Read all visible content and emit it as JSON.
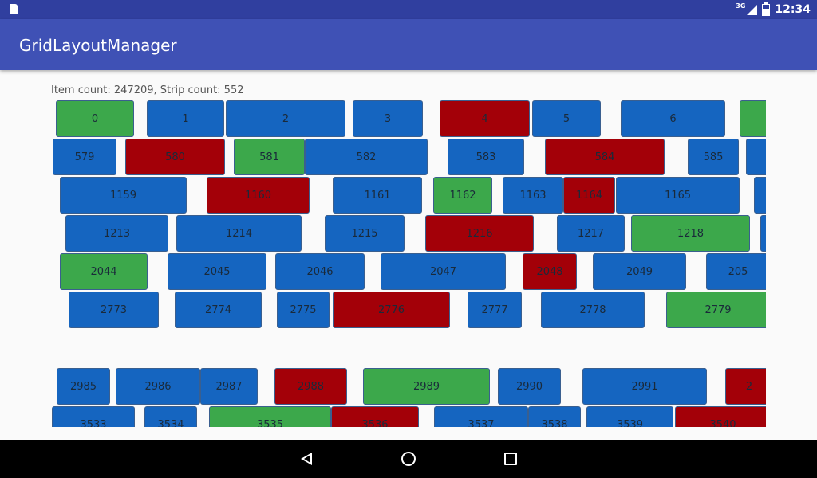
{
  "status_bar": {
    "time": "12:34",
    "network": "3G"
  },
  "app_bar": {
    "title": "GridLayoutManager"
  },
  "info": {
    "text": "Item count: 247209, Strip count: 552"
  },
  "colors": {
    "blue": "#1565c0",
    "red": "#a30008",
    "green": "#3ca84b"
  },
  "rows": [
    {
      "items": [
        [
          "0",
          "green"
        ],
        [
          "1",
          "blue"
        ],
        [
          "2",
          "blue"
        ],
        [
          "3",
          "blue"
        ],
        [
          "4",
          "red"
        ],
        [
          "5",
          "blue"
        ],
        [
          "6",
          "blue"
        ],
        [
          "",
          "green"
        ]
      ]
    },
    {
      "items": [
        [
          "579",
          "blue"
        ],
        [
          "580",
          "red"
        ],
        [
          "581",
          "green"
        ],
        [
          "582",
          "blue"
        ],
        [
          "583",
          "blue"
        ],
        [
          "584",
          "red"
        ],
        [
          "585",
          "blue"
        ],
        [
          "",
          "blue"
        ]
      ]
    },
    {
      "items": [
        [
          "1159",
          "blue"
        ],
        [
          "1160",
          "red"
        ],
        [
          "1161",
          "blue"
        ],
        [
          "1162",
          "green"
        ],
        [
          "1163",
          "blue"
        ],
        [
          "1164",
          "red"
        ],
        [
          "1165",
          "blue"
        ],
        [
          "",
          "blue"
        ]
      ]
    },
    {
      "items": [
        [
          "1213",
          "blue"
        ],
        [
          "1214",
          "blue"
        ],
        [
          "1215",
          "blue"
        ],
        [
          "1216",
          "red"
        ],
        [
          "1217",
          "blue"
        ],
        [
          "1218",
          "green"
        ],
        [
          "",
          "blue"
        ]
      ]
    },
    {
      "items": [
        [
          "2044",
          "green"
        ],
        [
          "2045",
          "blue"
        ],
        [
          "2046",
          "blue"
        ],
        [
          "2047",
          "blue"
        ],
        [
          "2048",
          "red"
        ],
        [
          "2049",
          "blue"
        ],
        [
          "205",
          "blue"
        ]
      ]
    },
    {
      "items": [
        [
          "2773",
          "blue"
        ],
        [
          "2774",
          "blue"
        ],
        [
          "2775",
          "blue"
        ],
        [
          "2776",
          "red"
        ],
        [
          "2777",
          "blue"
        ],
        [
          "2778",
          "blue"
        ],
        [
          "2779",
          "green"
        ]
      ]
    },
    {
      "items": [
        [
          "2985",
          "blue"
        ],
        [
          "2986",
          "blue"
        ],
        [
          "2987",
          "blue"
        ],
        [
          "2988",
          "red"
        ],
        [
          "2989",
          "green"
        ],
        [
          "2990",
          "blue"
        ],
        [
          "2991",
          "blue"
        ],
        [
          "2",
          "red"
        ]
      ]
    },
    {
      "items": [
        [
          "3533",
          "blue"
        ],
        [
          "3534",
          "blue"
        ],
        [
          "3535",
          "green"
        ],
        [
          "3536",
          "red"
        ],
        [
          "3537",
          "blue"
        ],
        [
          "3538",
          "blue"
        ],
        [
          "3539",
          "blue"
        ],
        [
          "3540",
          "red"
        ]
      ]
    }
  ]
}
